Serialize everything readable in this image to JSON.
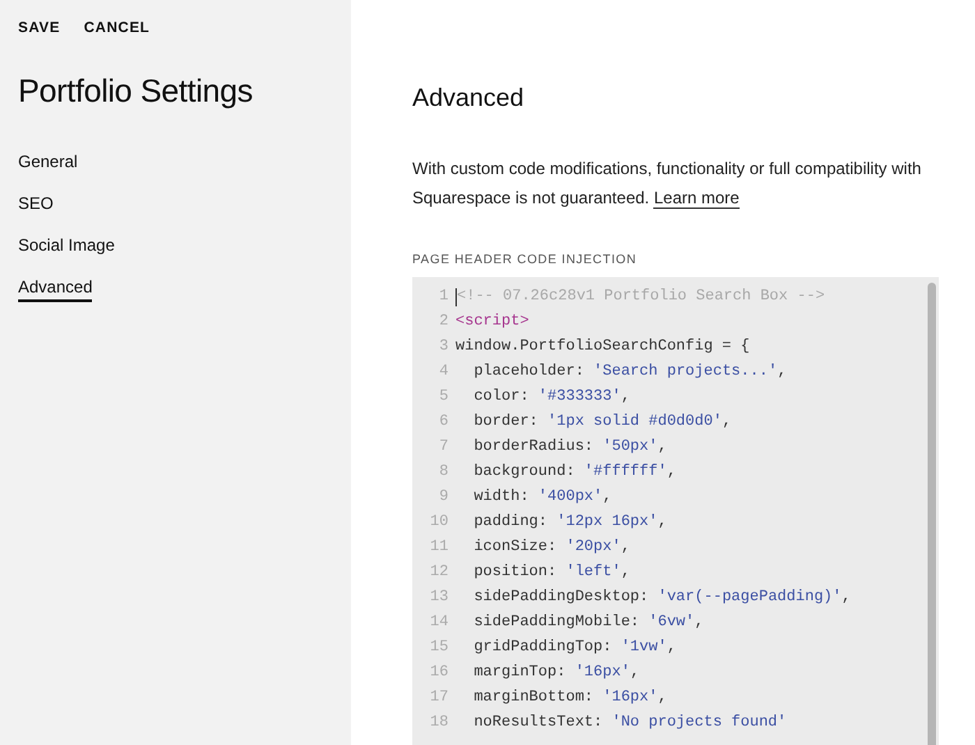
{
  "header_actions": [
    "SAVE",
    "CANCEL"
  ],
  "sidebar": {
    "title": "Portfolio Settings",
    "items": [
      {
        "label": "General",
        "selected": false
      },
      {
        "label": "SEO",
        "selected": false
      },
      {
        "label": "Social Image",
        "selected": false
      },
      {
        "label": "Advanced",
        "selected": true
      }
    ]
  },
  "main": {
    "title": "Advanced",
    "notice": "With custom code modifications, functionality or full compatibility with Squarespace is not guaranteed.",
    "notice_link": "Learn more",
    "section_label": "PAGE HEADER CODE INJECTION",
    "code_lines": [
      {
        "number": "1",
        "tokens": [
          {
            "kind": "comment",
            "text": "<!-- 07.26c28v1 Portfolio Search Box -->"
          }
        ]
      },
      {
        "number": "2",
        "tokens": [
          {
            "kind": "tag",
            "text": "<script>"
          }
        ]
      },
      {
        "number": "3",
        "tokens": [
          {
            "kind": "plain",
            "text": "window.PortfolioSearchConfig = {"
          }
        ]
      },
      {
        "number": "4",
        "tokens": [
          {
            "kind": "plain",
            "text": "  placeholder: "
          },
          {
            "kind": "string",
            "text": "'Search projects...'"
          },
          {
            "kind": "plain",
            "text": ","
          }
        ]
      },
      {
        "number": "5",
        "tokens": [
          {
            "kind": "plain",
            "text": "  color: "
          },
          {
            "kind": "string",
            "text": "'#333333'"
          },
          {
            "kind": "plain",
            "text": ","
          }
        ]
      },
      {
        "number": "6",
        "tokens": [
          {
            "kind": "plain",
            "text": "  border: "
          },
          {
            "kind": "string",
            "text": "'1px solid #d0d0d0'"
          },
          {
            "kind": "plain",
            "text": ","
          }
        ]
      },
      {
        "number": "7",
        "tokens": [
          {
            "kind": "plain",
            "text": "  borderRadius: "
          },
          {
            "kind": "string",
            "text": "'50px'"
          },
          {
            "kind": "plain",
            "text": ","
          }
        ]
      },
      {
        "number": "8",
        "tokens": [
          {
            "kind": "plain",
            "text": "  background: "
          },
          {
            "kind": "string",
            "text": "'#ffffff'"
          },
          {
            "kind": "plain",
            "text": ","
          }
        ]
      },
      {
        "number": "9",
        "tokens": [
          {
            "kind": "plain",
            "text": "  width: "
          },
          {
            "kind": "string",
            "text": "'400px'"
          },
          {
            "kind": "plain",
            "text": ","
          }
        ]
      },
      {
        "number": "10",
        "tokens": [
          {
            "kind": "plain",
            "text": "  padding: "
          },
          {
            "kind": "string",
            "text": "'12px 16px'"
          },
          {
            "kind": "plain",
            "text": ","
          }
        ]
      },
      {
        "number": "11",
        "tokens": [
          {
            "kind": "plain",
            "text": "  iconSize: "
          },
          {
            "kind": "string",
            "text": "'20px'"
          },
          {
            "kind": "plain",
            "text": ","
          }
        ]
      },
      {
        "number": "12",
        "tokens": [
          {
            "kind": "plain",
            "text": "  position: "
          },
          {
            "kind": "string",
            "text": "'left'"
          },
          {
            "kind": "plain",
            "text": ","
          }
        ]
      },
      {
        "number": "13",
        "tokens": [
          {
            "kind": "plain",
            "text": "  sidePaddingDesktop: "
          },
          {
            "kind": "string",
            "text": "'var(--pagePadding)'"
          },
          {
            "kind": "plain",
            "text": ","
          }
        ]
      },
      {
        "number": "14",
        "tokens": [
          {
            "kind": "plain",
            "text": "  sidePaddingMobile: "
          },
          {
            "kind": "string",
            "text": "'6vw'"
          },
          {
            "kind": "plain",
            "text": ","
          }
        ]
      },
      {
        "number": "15",
        "tokens": [
          {
            "kind": "plain",
            "text": "  gridPaddingTop: "
          },
          {
            "kind": "string",
            "text": "'1vw'"
          },
          {
            "kind": "plain",
            "text": ","
          }
        ]
      },
      {
        "number": "16",
        "tokens": [
          {
            "kind": "plain",
            "text": "  marginTop: "
          },
          {
            "kind": "string",
            "text": "'16px'"
          },
          {
            "kind": "plain",
            "text": ","
          }
        ]
      },
      {
        "number": "17",
        "tokens": [
          {
            "kind": "plain",
            "text": "  marginBottom: "
          },
          {
            "kind": "string",
            "text": "'16px'"
          },
          {
            "kind": "plain",
            "text": ","
          }
        ]
      },
      {
        "number": "18",
        "tokens": [
          {
            "kind": "plain",
            "text": "  noResultsText: "
          },
          {
            "kind": "string",
            "text": "'No projects found'"
          }
        ]
      }
    ]
  }
}
